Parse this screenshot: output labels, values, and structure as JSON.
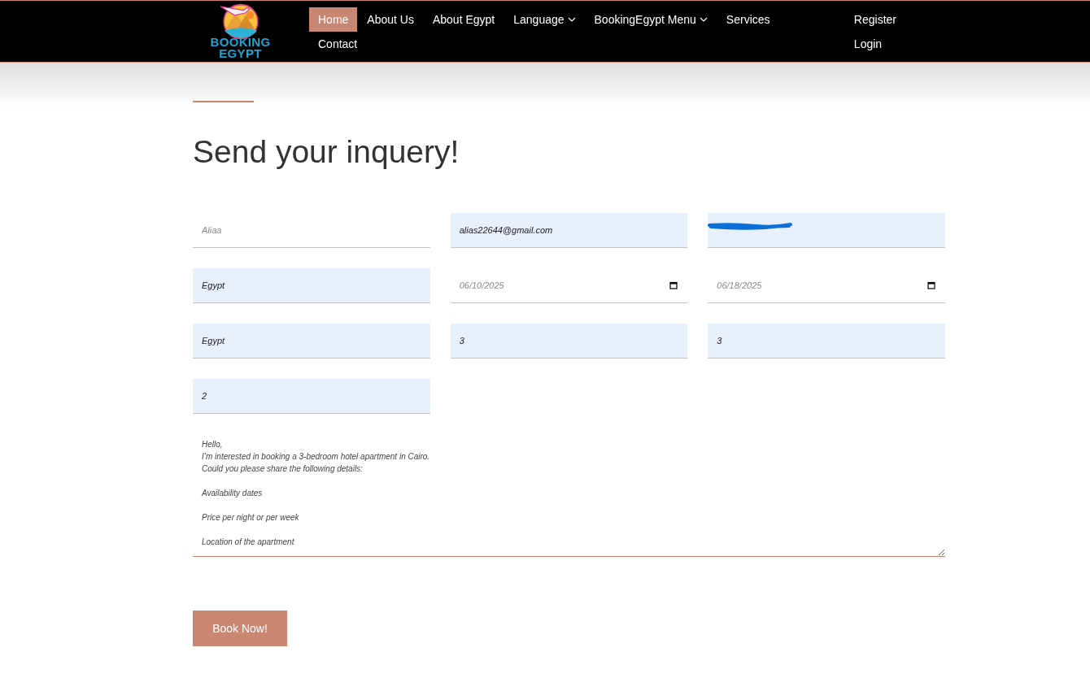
{
  "header": {
    "logo_lines": [
      "BOOKING",
      "EGYPT"
    ],
    "nav": [
      {
        "label": "Home",
        "selected": true,
        "dropdown": false
      },
      {
        "label": "About Us",
        "selected": false,
        "dropdown": false
      },
      {
        "label": "About Egypt",
        "selected": false,
        "dropdown": false
      },
      {
        "label": "Language",
        "selected": false,
        "dropdown": true
      },
      {
        "label": "BookingEgypt Menu",
        "selected": false,
        "dropdown": true
      },
      {
        "label": "Services",
        "selected": false,
        "dropdown": false
      },
      {
        "label": "Contact",
        "selected": false,
        "dropdown": false
      }
    ],
    "account_links": [
      "Register",
      "Login"
    ]
  },
  "form": {
    "title": "Send your inquery!",
    "fields": [
      {
        "kind": "text",
        "placeholder": "Aliaa",
        "autofilled": false
      },
      {
        "kind": "text",
        "value": "alias22644@gmail.com",
        "autofilled": true
      },
      {
        "kind": "redacted",
        "autofilled": true
      },
      {
        "kind": "text",
        "value": "Egypt",
        "autofilled": true
      },
      {
        "kind": "date",
        "value": "06/10/2025",
        "autofilled": false
      },
      {
        "kind": "date",
        "value": "06/18/2025",
        "autofilled": false
      },
      {
        "kind": "text",
        "value": "Egypt",
        "autofilled": true
      },
      {
        "kind": "text",
        "value": "3",
        "autofilled": true
      },
      {
        "kind": "text",
        "value": "3",
        "autofilled": true
      },
      {
        "kind": "text",
        "value": "2",
        "autofilled": true
      }
    ],
    "message": "Hello,\nI’m interested in booking a 3-bedroom hotel apartment in Cairo.\nCould you please share the following details:\n\nAvailability dates\n\nPrice per night or per week\n\nLocation of the apartment",
    "submit": "Book Now!"
  }
}
